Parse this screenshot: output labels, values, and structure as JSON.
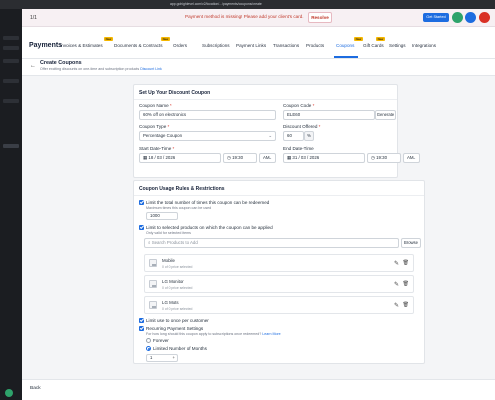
{
  "browser": {
    "url": "app.gohighlevel.com/v2/location/.../payments/coupons/create"
  },
  "top": {
    "pager": "1/1",
    "banner": "Payment method is missing! Please add your client's card.",
    "resolve": "Resolve",
    "get_started": "Get Started"
  },
  "nav": {
    "title": "Payments",
    "new_tag": "New",
    "tabs": [
      "Invoices & Estimates",
      "Documents & Contracts",
      "Orders",
      "Subscriptions",
      "Payment Links",
      "Transactions",
      "Products",
      "Coupons",
      "Gift Cards",
      "Settings",
      "Integrations"
    ]
  },
  "page": {
    "title": "Create Coupons",
    "subtitle": "Offer exciting discounts on one-time and subscription products",
    "subtitle_link": "Discount Link"
  },
  "setup": {
    "heading": "Set Up Your Discount Coupon",
    "name_label": "Coupon Name",
    "name_value": "60% off on electronics",
    "code_label": "Coupon Code",
    "code_value": "ELE60",
    "generate": "Generate",
    "type_label": "Coupon Type",
    "type_value": "Percentage Coupon",
    "offered_label": "Discount Offered",
    "offered_value": "60",
    "offered_unit": "%",
    "start_label": "Start Date-Time",
    "start_date": "18 / 03 / 2026",
    "start_time": "19:30",
    "start_ampm": "AM",
    "end_label": "End Date-Time",
    "end_date": "31 / 03 / 2026",
    "end_time": "19:30",
    "end_ampm": "AM",
    "req": "*"
  },
  "rules": {
    "heading": "Coupon Usage Rules & Restrictions",
    "limit_label": "Limit the total number of times this coupon can be redeemed",
    "limit_hint": "Maximum times this coupon can be used",
    "limit_value": "1000",
    "products_label": "Limit to selected products on which the coupon can be applied",
    "products_hint": "Only valid for selected items",
    "search_placeholder": "Search Products to Add",
    "browse": "Browse",
    "products": [
      {
        "name": "Mobile",
        "sel": "0 of 0 price selected"
      },
      {
        "name": "LG Monitor",
        "sel": "0 of 0 price selected"
      },
      {
        "name": "LG Mots",
        "sel": "0 of 0 price selected"
      }
    ],
    "once_label": "Limit use to once per customer",
    "recurring_label": "Recurring Payment Settings",
    "recurring_hint": "For how long should this coupon apply to subscriptions once redeemed?",
    "learn_more": "Learn More",
    "opt_forever": "Forever",
    "opt_limited": "Limited Number of Months",
    "months_value": "1"
  },
  "bottom": {
    "back": "Back"
  }
}
